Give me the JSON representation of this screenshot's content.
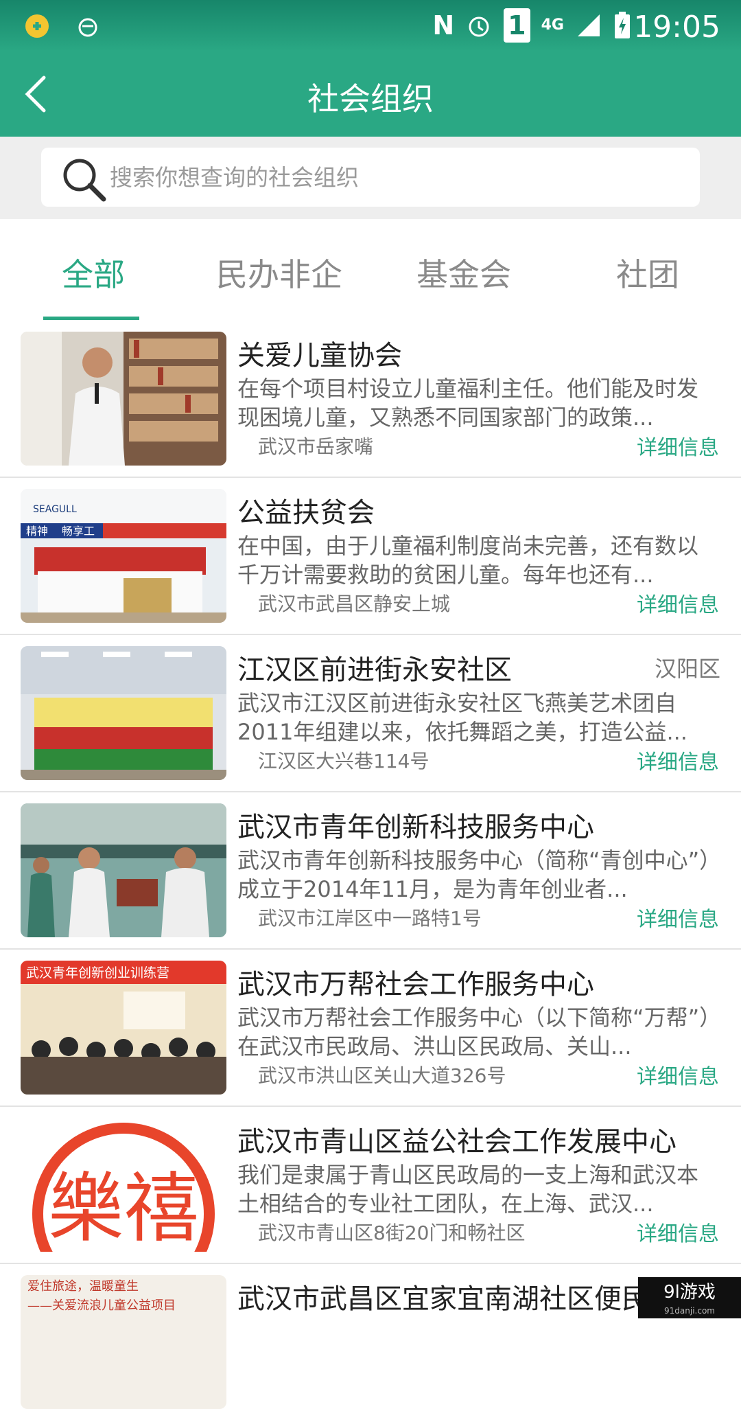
{
  "status_bar": {
    "time": "19:05",
    "network": "4G",
    "sim": "1",
    "n_badge": "N"
  },
  "header": {
    "title": "社会组织"
  },
  "search": {
    "placeholder": "搜索你想查询的社会组织"
  },
  "tabs": [
    {
      "label": "全部",
      "active": true
    },
    {
      "label": "民办非企",
      "active": false
    },
    {
      "label": "基金会",
      "active": false
    },
    {
      "label": "社团",
      "active": false
    }
  ],
  "colors": {
    "accent": "#2aa884",
    "status": "#17866a",
    "search_bg": "#eeeeee"
  },
  "organizations": [
    {
      "title": "关爱儿童协会",
      "region": "",
      "description": "在每个项目村设立儿童福利主任。他们能及时发现困境儿童，又熟悉不同国家部门的政策...",
      "address": "武汉市岳家嘴",
      "detail_link": "详细信息"
    },
    {
      "title": "公益扶贫会",
      "region": "",
      "description": "在中国，由于儿童福利制度尚未完善，还有数以千万计需要救助的贫困儿童。每年也还有...",
      "address": "武汉市武昌区静安上城",
      "detail_link": "详细信息"
    },
    {
      "title": "江汉区前进街永安社区",
      "region": "汉阳区",
      "description": "武汉市江汉区前进街永安社区飞燕美艺术团自2011年组建以来，依托舞蹈之美，打造公益...",
      "address": "江汉区大兴巷114号",
      "detail_link": "详细信息"
    },
    {
      "title": "武汉市青年创新科技服务中心",
      "region": "",
      "description": "武汉市青年创新科技服务中心（简称“青创中心”）成立于2014年11月，是为青年创业者...",
      "address": "武汉市江岸区中一路特1号",
      "detail_link": "详细信息"
    },
    {
      "title": "武汉市万帮社会工作服务中心",
      "region": "",
      "description": "武汉市万帮社会工作服务中心（以下简称“万帮”）在武汉市民政局、洪山区民政局、关山...",
      "address": "武汉市洪山区关山大道326号",
      "detail_link": "详细信息"
    },
    {
      "title": "武汉市青山区益公社会工作发展中心",
      "region": "",
      "description": "我们是隶属于青山区民政局的一支上海和武汉本土相结合的专业社工团队，在上海、武汉...",
      "address": "武汉市青山区8街20门和畅社区",
      "detail_link": "详细信息"
    },
    {
      "title": "武汉市武昌区宜家宜南湖社区便民服务中心",
      "region": "",
      "description": "",
      "address": "",
      "detail_link": ""
    }
  ],
  "thumb_texts": {
    "seagull": "SEAGULL",
    "banner_left": "精神",
    "banner_right": "畅享工",
    "training_banner": "武汉青年创新创业训练营",
    "logo_chars": "樂禧",
    "poster_line1": "爱住旅途，温暖童生",
    "poster_line2": "——关爱流浪儿童公益项目"
  },
  "watermark": {
    "brand": "9l游戏",
    "url": "91danji.com"
  }
}
